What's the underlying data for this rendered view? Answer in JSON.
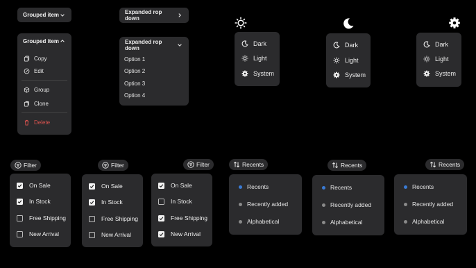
{
  "grouped": {
    "collapsed_label": "Grouped item",
    "expanded_label": "Grouped item",
    "items": [
      {
        "label": "Copy",
        "icon": "copy-icon"
      },
      {
        "label": "Edit",
        "icon": "edit-icon"
      },
      {
        "label": "Group",
        "icon": "group-icon"
      },
      {
        "label": "Clone",
        "icon": "clone-icon"
      },
      {
        "label": "Delete",
        "icon": "trash-icon",
        "color": "#d9534f"
      }
    ]
  },
  "expanded_dropdown": {
    "collapsed_label": "Expanded rop down",
    "expanded_label": "Expanded rop down",
    "options": [
      "Option 1",
      "Option 2",
      "Option 3",
      "Option 4"
    ]
  },
  "theme_menus": [
    {
      "trigger_icon": "sun-icon",
      "items": [
        "Dark",
        "Light",
        "System"
      ]
    },
    {
      "trigger_icon": "moon-icon",
      "items": [
        "Dark",
        "Light",
        "System"
      ]
    },
    {
      "trigger_icon": "gear-icon",
      "items": [
        "Dark",
        "Light",
        "System"
      ]
    }
  ],
  "filter_menus": [
    {
      "label": "Filter",
      "items": [
        {
          "label": "On Sale",
          "checked": true
        },
        {
          "label": "In Stock",
          "checked": true
        },
        {
          "label": "Free Shipping",
          "checked": false
        },
        {
          "label": "New Arrival",
          "checked": false
        }
      ]
    },
    {
      "label": "Filter",
      "items": [
        {
          "label": "On Sale",
          "checked": true
        },
        {
          "label": "In Stock",
          "checked": true
        },
        {
          "label": "Free Shipping",
          "checked": false
        },
        {
          "label": "New Arrival",
          "checked": false
        }
      ]
    },
    {
      "label": "Filter",
      "items": [
        {
          "label": "On Sale",
          "checked": true
        },
        {
          "label": "In Stock",
          "checked": false
        },
        {
          "label": "Free Shipping",
          "checked": true
        },
        {
          "label": "New Arrival",
          "checked": true
        }
      ]
    }
  ],
  "sort_menus": [
    {
      "label": "Recents",
      "items": [
        "Recents",
        "Recently added",
        "Alphabetical"
      ],
      "selected": 0
    },
    {
      "label": "Recents",
      "items": [
        "Recents",
        "Recently added",
        "Alphabetical"
      ],
      "selected": 0
    },
    {
      "label": "Recents",
      "items": [
        "Recents",
        "Recently added",
        "Alphabetical"
      ],
      "selected": 0
    }
  ],
  "colors": {
    "accent": "#3a7bd5",
    "panel": "#2b2b2d",
    "delete": "#d9534f",
    "inactive_dot": "#8a8a8a"
  }
}
